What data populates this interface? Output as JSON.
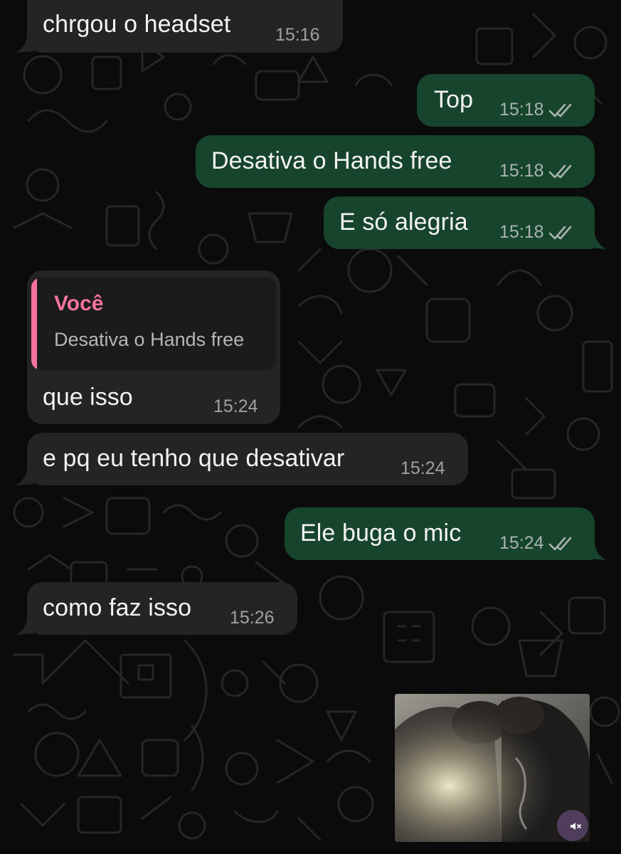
{
  "chat": {
    "messages": [
      {
        "direction": "incoming",
        "text": "chrgou o headset",
        "time": "15:16"
      },
      {
        "direction": "outgoing",
        "text": "Top",
        "time": "15:18",
        "status": "read"
      },
      {
        "direction": "outgoing",
        "text": "Desativa o Hands free",
        "time": "15:18",
        "status": "read"
      },
      {
        "direction": "outgoing",
        "text": "E só alegria",
        "time": "15:18",
        "status": "read"
      },
      {
        "direction": "incoming",
        "reply_to": {
          "author": "Você",
          "text": "Desativa o Hands free"
        },
        "text": "que isso",
        "time": "15:24"
      },
      {
        "direction": "incoming",
        "text": "e pq eu tenho que desativar",
        "time": "15:24"
      },
      {
        "direction": "outgoing",
        "text": "Ele buga o mic",
        "time": "15:24",
        "status": "read"
      },
      {
        "direction": "incoming",
        "text": "como faz isso",
        "time": "15:26"
      },
      {
        "direction": "outgoing",
        "type": "video",
        "muted": true,
        "icon": "speaker-muted-icon"
      }
    ]
  },
  "colors": {
    "background": "#0b0b0b",
    "incoming_bubble": "#242424",
    "outgoing_bubble": "#17442d",
    "reply_accent": "#f5749c",
    "read_tick": "#a9b3ad"
  },
  "icons": {
    "read_receipt": "double-check-icon",
    "muted": "speaker-muted-icon"
  }
}
